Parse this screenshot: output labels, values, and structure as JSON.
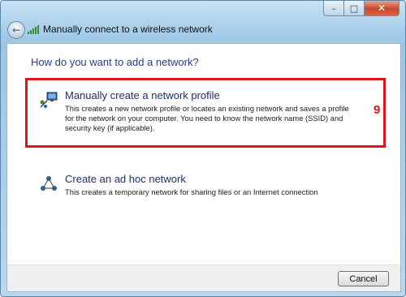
{
  "window": {
    "title": "Manually connect to a wireless network",
    "caption_buttons": {
      "minimize": "–",
      "maximize": "□",
      "close": "✕"
    },
    "back_glyph": "←"
  },
  "main": {
    "heading": "How do you want to add a network?",
    "options": [
      {
        "title": "Manually create a network profile",
        "description": "This creates a new network profile or locates an existing network and saves a profile for the network on your computer. You need to know the network name (SSID) and security key (if applicable).",
        "icon": "network-profile-icon"
      },
      {
        "title": "Create an ad hoc network",
        "description": "This creates a temporary network for sharing files or an Internet connection",
        "icon": "ad-hoc-network-icon"
      }
    ],
    "annotation_number": "9",
    "highlight_color": "#e0141e"
  },
  "footer": {
    "cancel_label": "Cancel"
  }
}
